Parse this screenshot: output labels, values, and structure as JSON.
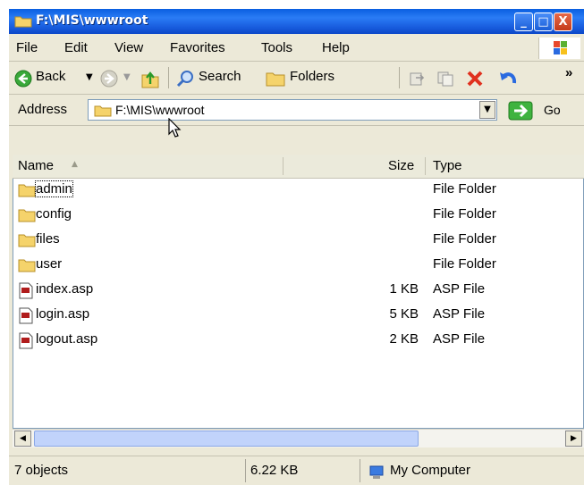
{
  "window": {
    "title": "F:\\MIS\\wwwroot",
    "controls": {
      "minimize": "_",
      "maximize": "□",
      "close": "X"
    }
  },
  "menu": [
    "File",
    "Edit",
    "View",
    "Favorites",
    "Tools",
    "Help"
  ],
  "toolbar": {
    "back_label": "Back",
    "search_label": "Search",
    "folders_label": "Folders",
    "more": "»"
  },
  "address": {
    "label": "Address",
    "value": "F:\\MIS\\wwwroot",
    "go_label": "Go"
  },
  "columns": {
    "name": "Name",
    "size": "Size",
    "type": "Type"
  },
  "files": [
    {
      "name": "admin",
      "size": "",
      "type": "File Folder",
      "icon": "folder-icon"
    },
    {
      "name": "config",
      "size": "",
      "type": "File Folder",
      "icon": "folder-icon"
    },
    {
      "name": "files",
      "size": "",
      "type": "File Folder",
      "icon": "folder-icon"
    },
    {
      "name": "user",
      "size": "",
      "type": "File Folder",
      "icon": "folder-icon"
    },
    {
      "name": "index.asp",
      "size": "1 KB",
      "type": "ASP File",
      "icon": "asp-file-icon"
    },
    {
      "name": "login.asp",
      "size": "5 KB",
      "type": "ASP File",
      "icon": "asp-file-icon"
    },
    {
      "name": "logout.asp",
      "size": "2 KB",
      "type": "ASP File",
      "icon": "asp-file-icon"
    }
  ],
  "status": {
    "objects": "7 objects",
    "size": "6.22 KB",
    "zone": "My Computer"
  },
  "colors": {
    "titlebar": "#1a5fe0",
    "chrome": "#ece9d8",
    "go": "#2fa52f"
  }
}
